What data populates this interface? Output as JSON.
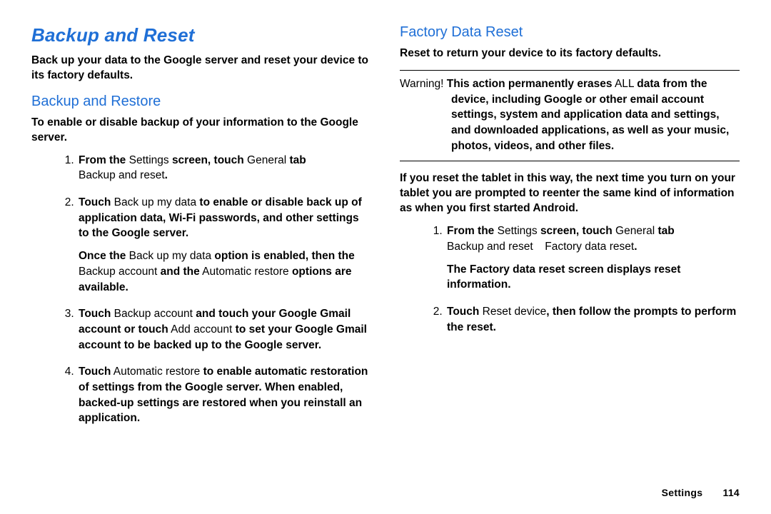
{
  "left": {
    "section_title": "Backup and Reset",
    "intro": "Back up your data to the Google server and reset your device to its factory defaults.",
    "sub_title": "Backup and Restore",
    "lead": "To enable or disable backup of your information to the Google server.",
    "steps": {
      "s1_a": "From the",
      "s1_b": " Settings ",
      "s1_c": "screen, touch",
      "s1_d": " General ",
      "s1_e": "tab ",
      "s1_f": "Backup and reset",
      "s1_g": ".",
      "s2_a": "Touch",
      "s2_b": " Back up my data ",
      "s2_c": "to enable or disable back up of application data, Wi-Fi passwords, and other settings to the Google server.",
      "s2_n_a": "Once the",
      "s2_n_b": " Back up my data ",
      "s2_n_c": "option is enabled, then the",
      "s2_n_d": " Backup account ",
      "s2_n_e": "and the",
      "s2_n_f": " Automatic restore ",
      "s2_n_g": "options are available.",
      "s3_a": "Touch",
      "s3_b": " Backup account ",
      "s3_c": "and touch your Google Gmail account or touch",
      "s3_d": " Add account ",
      "s3_e": "to set your Google Gmail account to be backed up to the Google server.",
      "s4_a": "Touch",
      "s4_b": " Automatic restore ",
      "s4_c": "to enable automatic restoration of settings from the Google server. When enabled, backed-up settings are restored when you reinstall an application."
    }
  },
  "right": {
    "sub_title": "Factory Data Reset",
    "intro": "Reset to return your device to its factory defaults.",
    "warn_label": "Warning! ",
    "warn_a": "This action permanently erases",
    "warn_b": " ALL ",
    "warn_c": "data from the device, including Google or other email account settings, system and application data and settings, and downloaded applications, as well as your music, photos, videos, and other files.",
    "post_warn": "If you reset the tablet in this way, the next time you turn on your tablet you are prompted to reenter the same kind of information as when you first started Android.",
    "steps": {
      "s1_a": "From the",
      "s1_b": " Settings ",
      "s1_c": "screen, touch",
      "s1_d": " General ",
      "s1_e": "tab ",
      "s1_f": "Backup and reset ",
      "s1_arrow": " ",
      "s1_g": " Factory data reset",
      "s1_h": ".",
      "s1_n": "The Factory data reset screen displays reset information.",
      "s2_a": "Touch",
      "s2_b": " Reset device",
      "s2_c": ", then follow the prompts to perform the reset."
    }
  },
  "footer": {
    "label": "Settings",
    "page": "114"
  }
}
